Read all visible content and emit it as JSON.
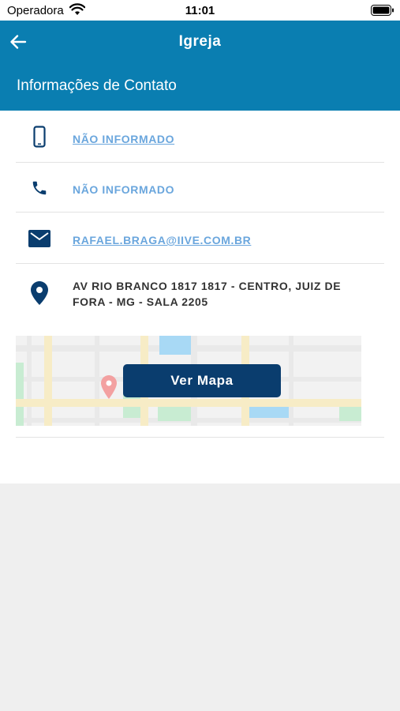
{
  "status_bar": {
    "carrier": "Operadora",
    "time": "11:01",
    "wifi_icon": "wifi-icon",
    "battery_icon": "battery-icon"
  },
  "header": {
    "title": "Igreja",
    "section_title": "Informações de Contato",
    "back_icon": "arrow-left-icon",
    "background_color": "#0a7eb1"
  },
  "contact": {
    "mobile": {
      "icon": "smartphone-icon",
      "value": "NÃO INFORMADO"
    },
    "phone": {
      "icon": "phone-icon",
      "value": "NÃO INFORMADO"
    },
    "email": {
      "icon": "mail-icon",
      "value": "RAFAEL.BRAGA@IIVE.COM.BR"
    },
    "address": {
      "icon": "location-pin-icon",
      "value": "AV RIO BRANCO 1817 1817 - CENTRO, JUIZ DE FORA - MG - SALA 2205"
    }
  },
  "map": {
    "button_label": "Ver Mapa",
    "button_color": "#0a3d6e",
    "pin_icon": "map-pin-icon"
  },
  "colors": {
    "link": "#6aa6dd",
    "icon": "#0a3d6e"
  }
}
